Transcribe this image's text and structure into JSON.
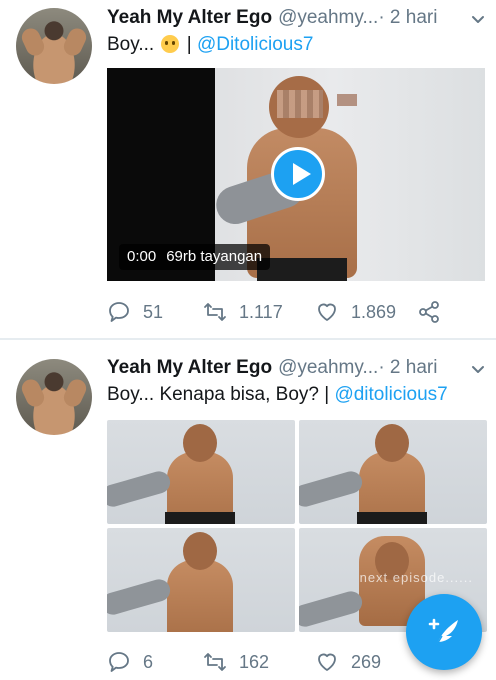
{
  "tweets": [
    {
      "display_name": "Yeah My Alter Ego",
      "handle": "@yeahmy...",
      "time": " · 2 hari",
      "text_prefix": "Boy... ",
      "text_sep": " | ",
      "mention": "@Ditolicious7",
      "video": {
        "duration": "0:00",
        "views": "69rb tayangan"
      },
      "replies": "51",
      "retweets": "1.117",
      "likes": "1.869"
    },
    {
      "display_name": "Yeah My Alter Ego",
      "handle": "@yeahmy...",
      "time": " · 2 hari",
      "text_prefix": "Boy... Kenapa bisa, Boy? | ",
      "mention": "@ditolicious7",
      "image_watermark": "next episode......",
      "replies": "6",
      "retweets": "162",
      "likes": "269"
    }
  ],
  "icons": {
    "reply": "reply-icon",
    "retweet": "retweet-icon",
    "like": "heart-icon",
    "share": "share-icon",
    "compose": "compose-tweet-icon",
    "caret": "chevron-down-icon",
    "play": "play-icon"
  },
  "colors": {
    "accent": "#1da1f2",
    "secondary_text": "#657786",
    "primary_text": "#14171a"
  }
}
